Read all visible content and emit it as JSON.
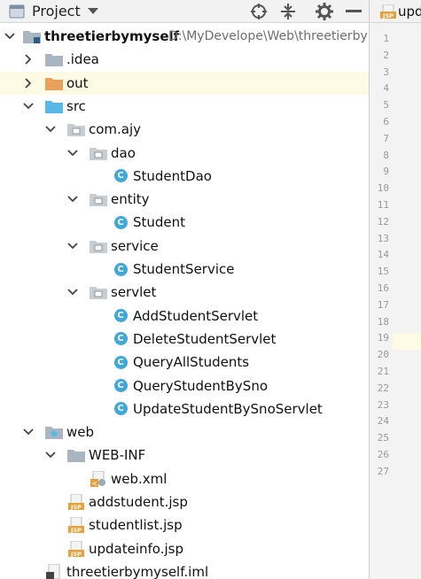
{
  "panel": {
    "title": "Project",
    "icons": [
      "project-panel-icon",
      "chevron-down-icon",
      "crosshair-icon",
      "collapse-all-icon",
      "gear-icon",
      "minimize-icon"
    ]
  },
  "tree": [
    {
      "label": "threetierbymyself",
      "path": "D:\\MyDevelope\\Web\\threetierbymyself",
      "bold": true,
      "icon": "module-folder-icon",
      "arrow": "expanded",
      "depth": 0
    },
    {
      "label": ".idea",
      "icon": "folder-icon",
      "arrow": "collapsed",
      "depth": 1
    },
    {
      "label": "out",
      "icon": "output-folder-icon",
      "arrow": "collapsed",
      "depth": 1,
      "highlight": true
    },
    {
      "label": "src",
      "icon": "source-folder-icon",
      "arrow": "expanded",
      "depth": 1
    },
    {
      "label": "com.ajy",
      "icon": "package-icon",
      "arrow": "expanded",
      "depth": 2
    },
    {
      "label": "dao",
      "icon": "package-icon",
      "arrow": "expanded",
      "depth": 3
    },
    {
      "label": "StudentDao",
      "icon": "java-class-icon",
      "depth": 4
    },
    {
      "label": "entity",
      "icon": "package-icon",
      "arrow": "expanded",
      "depth": 3
    },
    {
      "label": "Student",
      "icon": "java-class-icon",
      "depth": 4
    },
    {
      "label": "service",
      "icon": "package-icon",
      "arrow": "expanded",
      "depth": 3
    },
    {
      "label": "StudentService",
      "icon": "java-class-icon",
      "depth": 4
    },
    {
      "label": "servlet",
      "icon": "package-icon",
      "arrow": "expanded",
      "depth": 3
    },
    {
      "label": "AddStudentServlet",
      "icon": "java-class-icon",
      "depth": 4
    },
    {
      "label": "DeleteStudentServlet",
      "icon": "java-class-icon",
      "depth": 4
    },
    {
      "label": "QueryAllStudents",
      "icon": "java-class-icon",
      "depth": 4
    },
    {
      "label": "QueryStudentBySno",
      "icon": "java-class-icon",
      "depth": 4
    },
    {
      "label": "UpdateStudentBySnoServlet",
      "icon": "java-class-icon",
      "depth": 4
    },
    {
      "label": "web",
      "icon": "web-folder-icon",
      "arrow": "expanded",
      "depth": 1
    },
    {
      "label": "WEB-INF",
      "icon": "folder-icon",
      "arrow": "expanded",
      "depth": 2
    },
    {
      "label": "web.xml",
      "icon": "xml-file-icon",
      "depth": 3
    },
    {
      "label": "addstudent.jsp",
      "icon": "jsp-file-icon",
      "depth": 2
    },
    {
      "label": "studentlist.jsp",
      "icon": "jsp-file-icon",
      "depth": 2
    },
    {
      "label": "updateinfo.jsp",
      "icon": "jsp-file-icon",
      "depth": 2
    },
    {
      "label": "threetierbymyself.iml",
      "icon": "iml-file-icon",
      "depth": 1
    }
  ],
  "editor": {
    "tab_label": "upd",
    "tab_icon": "jsp-file-icon",
    "line_numbers": [
      "1",
      "2",
      "3",
      "4",
      "5",
      "6",
      "7",
      "8",
      "9",
      "10",
      "11",
      "12",
      "13",
      "14",
      "15",
      "16",
      "17",
      "18",
      "19",
      "20",
      "21",
      "22",
      "23",
      "24",
      "25",
      "26",
      "27"
    ],
    "current_line": "18"
  },
  "colors": {
    "folder": "#a9b6c2",
    "package": "#c8cdd2",
    "source_folder": "#58b8e6",
    "output_folder": "#e8a05a",
    "java_class": "#40a8d8",
    "jsp": "#e8a03a",
    "highlight_row": "#fdfbe4"
  }
}
